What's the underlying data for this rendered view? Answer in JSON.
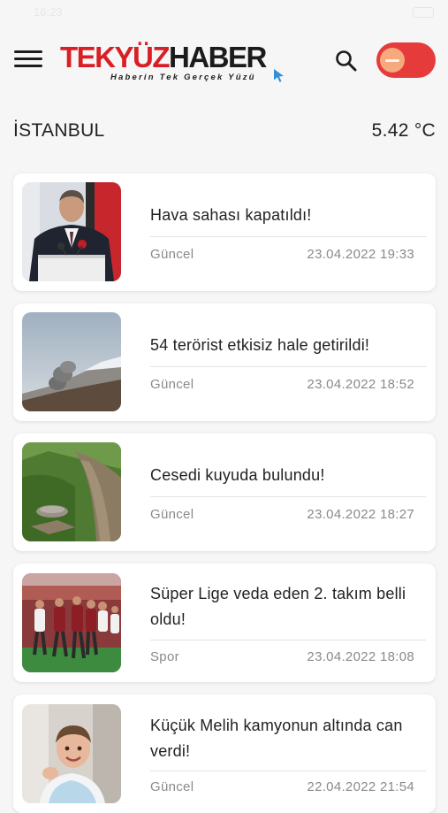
{
  "status_bar": {
    "time": "16:23"
  },
  "header": {
    "logo_main_red": "TEKYÜZ",
    "logo_main_dark": "HABER",
    "logo_tagline": "Haberin Tek Gerçek Yüzü",
    "menu_icon": "hamburger-menu-icon",
    "search_icon": "search-icon",
    "theme_toggle": {
      "state": "on",
      "color": "#e53b3b"
    }
  },
  "weather": {
    "city": "İSTANBUL",
    "temperature": "5.42 °C"
  },
  "news": [
    {
      "title": "Hava sahası kapatıldı!",
      "category": "Güncel",
      "date": "23.04.2022 19:33",
      "image": "politician-at-podium-photo"
    },
    {
      "title": "54 terörist etkisiz hale getirildi!",
      "category": "Güncel",
      "date": "23.04.2022 18:52",
      "image": "mountain-smoke-photo"
    },
    {
      "title": "Cesedi kuyuda bulundu!",
      "category": "Güncel",
      "date": "23.04.2022 18:27",
      "image": "grassy-hillside-well-photo"
    },
    {
      "title": "Süper Lige veda eden 2. takım belli oldu!",
      "category": "Spor",
      "date": "23.04.2022 18:08",
      "image": "football-match-photo"
    },
    {
      "title": "Küçük Melih kamyonun altında can verdi!",
      "category": "Güncel",
      "date": "22.04.2022 21:54",
      "image": "smiling-child-photo"
    }
  ],
  "colors": {
    "accent_red": "#d91f26",
    "background": "#f6f6f6",
    "card": "#ffffff",
    "meta_text": "#8a8a8a"
  }
}
